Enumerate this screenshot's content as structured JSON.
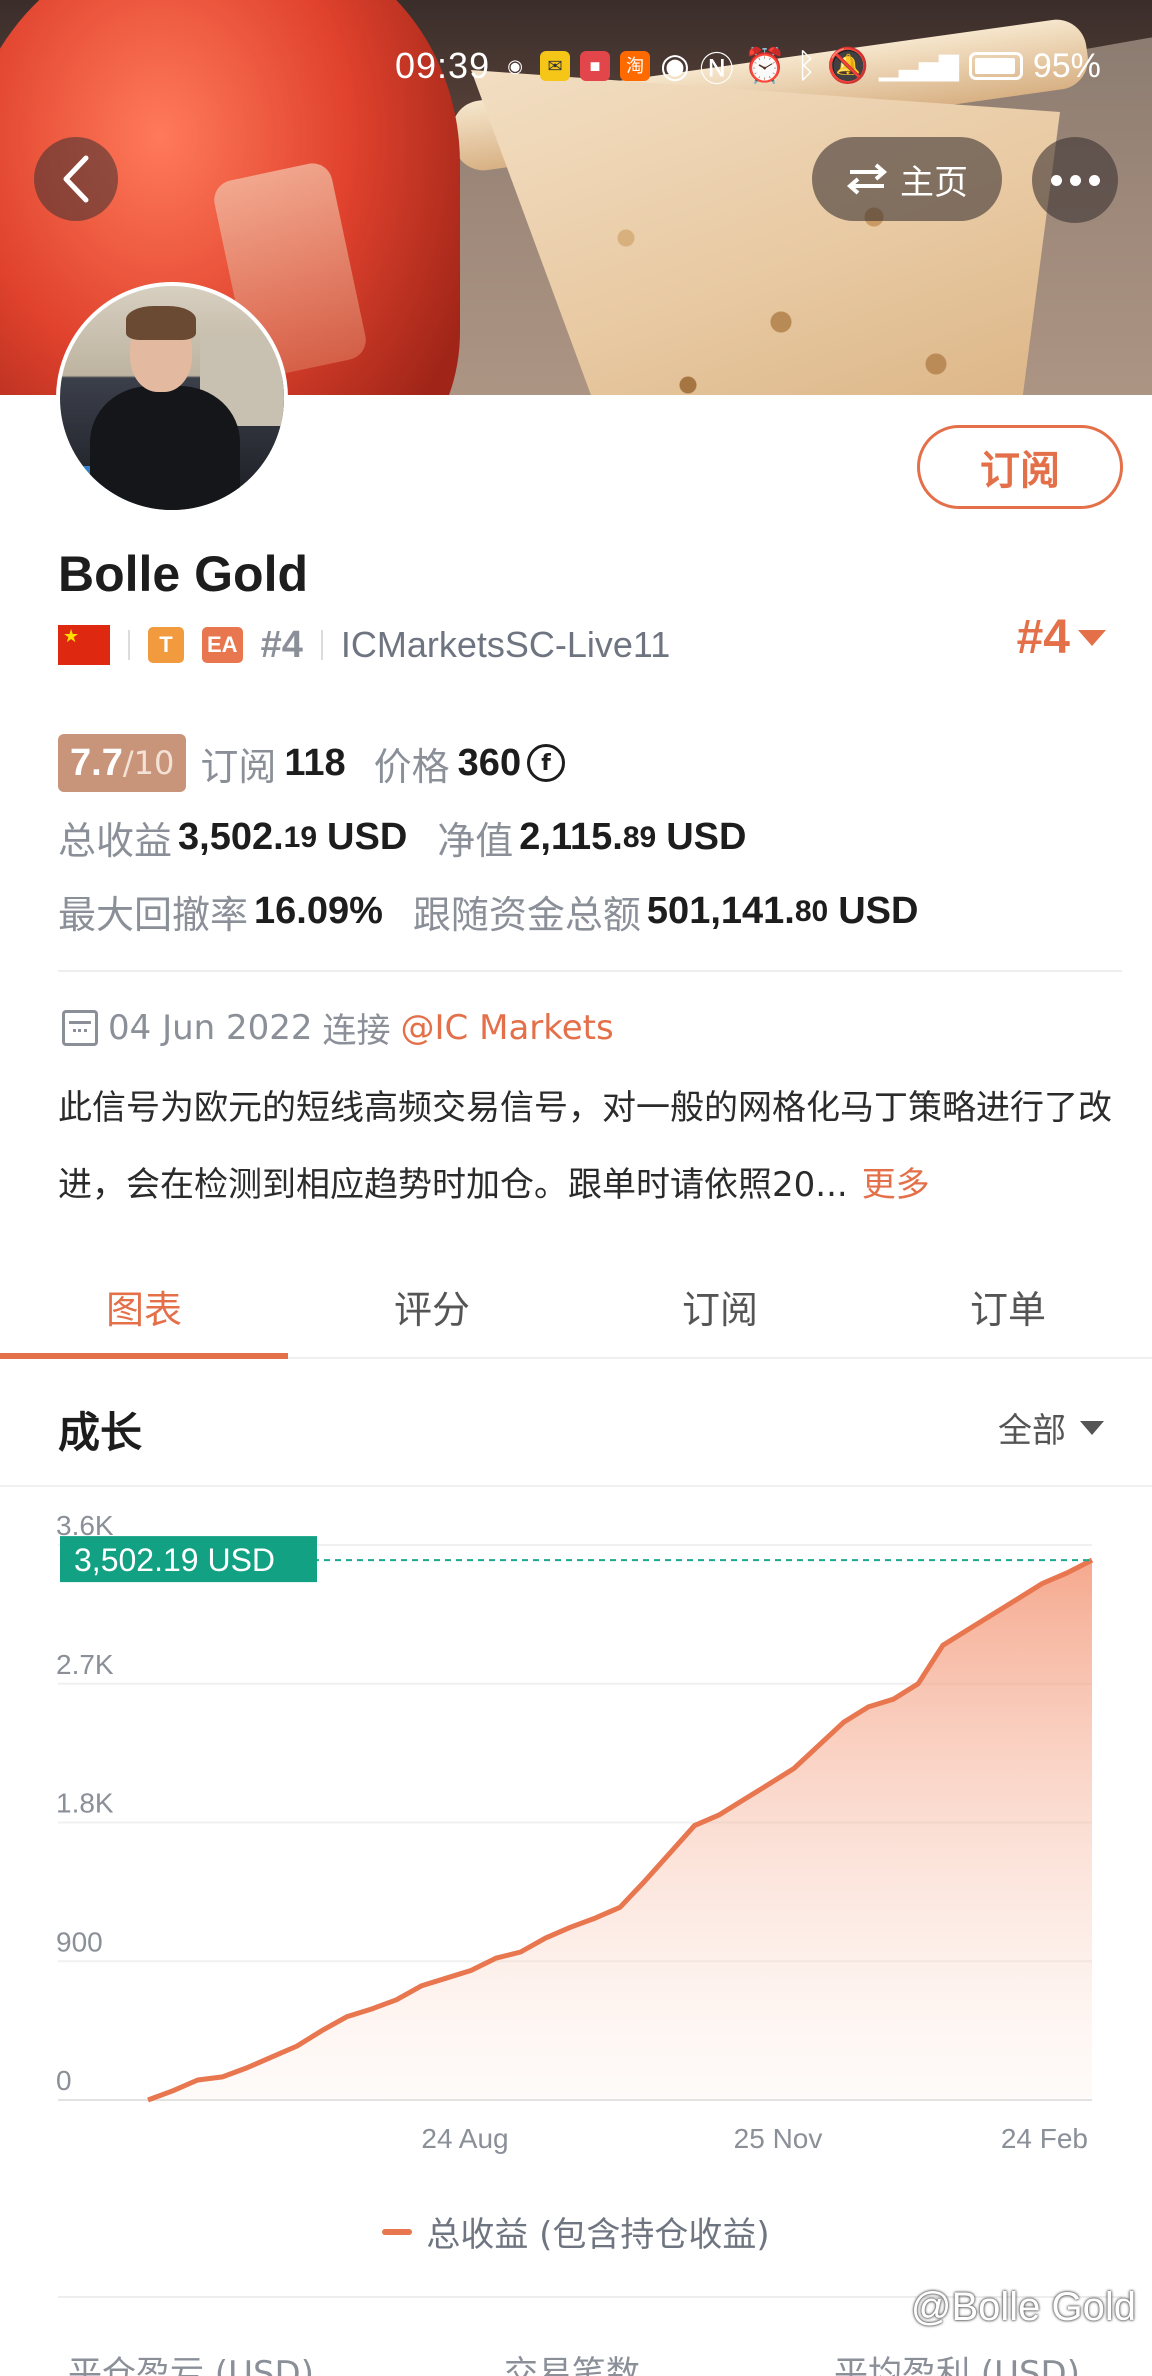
{
  "status_bar": {
    "time": "09:39",
    "battery": "95%"
  },
  "header": {
    "home_label": "主页"
  },
  "profile": {
    "subscribe_label": "订阅",
    "name": "Bolle Gold",
    "badge_t": "T",
    "badge_ea": "EA",
    "rank_small": "#4",
    "server": "ICMarketsSC-Live11",
    "rank_big": "#4"
  },
  "stats": {
    "score": "7.7",
    "score_max": "/10",
    "subscriptions_label": "订阅",
    "subscriptions_value": "118",
    "price_label": "价格",
    "price_value": "360",
    "total_profit_label": "总收益",
    "total_profit_int": "3,502.",
    "total_profit_dec": "19",
    "total_profit_unit": "USD",
    "equity_label": "净值",
    "equity_int": "2,115.",
    "equity_dec": "89",
    "equity_unit": "USD",
    "max_drawdown_label": "最大回撤率",
    "max_drawdown_value": "16.09%",
    "follow_funds_label": "跟随资金总额",
    "follow_funds_int": "501,141.",
    "follow_funds_dec": "80",
    "follow_funds_unit": "USD"
  },
  "connection": {
    "date": "04 Jun 2022",
    "connect_label": "连接",
    "broker": "@IC Markets"
  },
  "description": {
    "text": "此信号为欧元的短线高频交易信号，对一般的网格化马丁策略进行了改进，会在检测到相应趋势时加仓。跟单时请依照20...",
    "more_label": "更多"
  },
  "tabs": [
    "图表",
    "评分",
    "订阅",
    "订单"
  ],
  "growth": {
    "title": "成长",
    "range_label": "全部"
  },
  "chart_data": {
    "type": "area",
    "current_value_label": "3,502.19 USD",
    "y_ticks": [
      "0",
      "900",
      "1.8K",
      "2.7K",
      "3.6K"
    ],
    "ylim": [
      0,
      3600
    ],
    "x_ticks": [
      "24 Aug",
      "25 Nov",
      "24 Feb"
    ],
    "series": [
      {
        "name": "总收益 (包含持仓收益)",
        "color": "#e8764f",
        "values": [
          0,
          60,
          130,
          150,
          210,
          280,
          350,
          450,
          540,
          590,
          650,
          740,
          790,
          840,
          920,
          960,
          1050,
          1120,
          1180,
          1250,
          1420,
          1600,
          1780,
          1850,
          1950,
          2050,
          2150,
          2300,
          2450,
          2550,
          2600,
          2700,
          2950,
          3050,
          3150,
          3250,
          3350,
          3420,
          3502
        ]
      }
    ]
  },
  "legend_label": "总收益 (包含持仓收益)",
  "footer_columns": [
    "平仓盈亏 (USD)",
    "交易笔数",
    "平均盈利 (USD)"
  ],
  "watermark": "@Bolle Gold"
}
